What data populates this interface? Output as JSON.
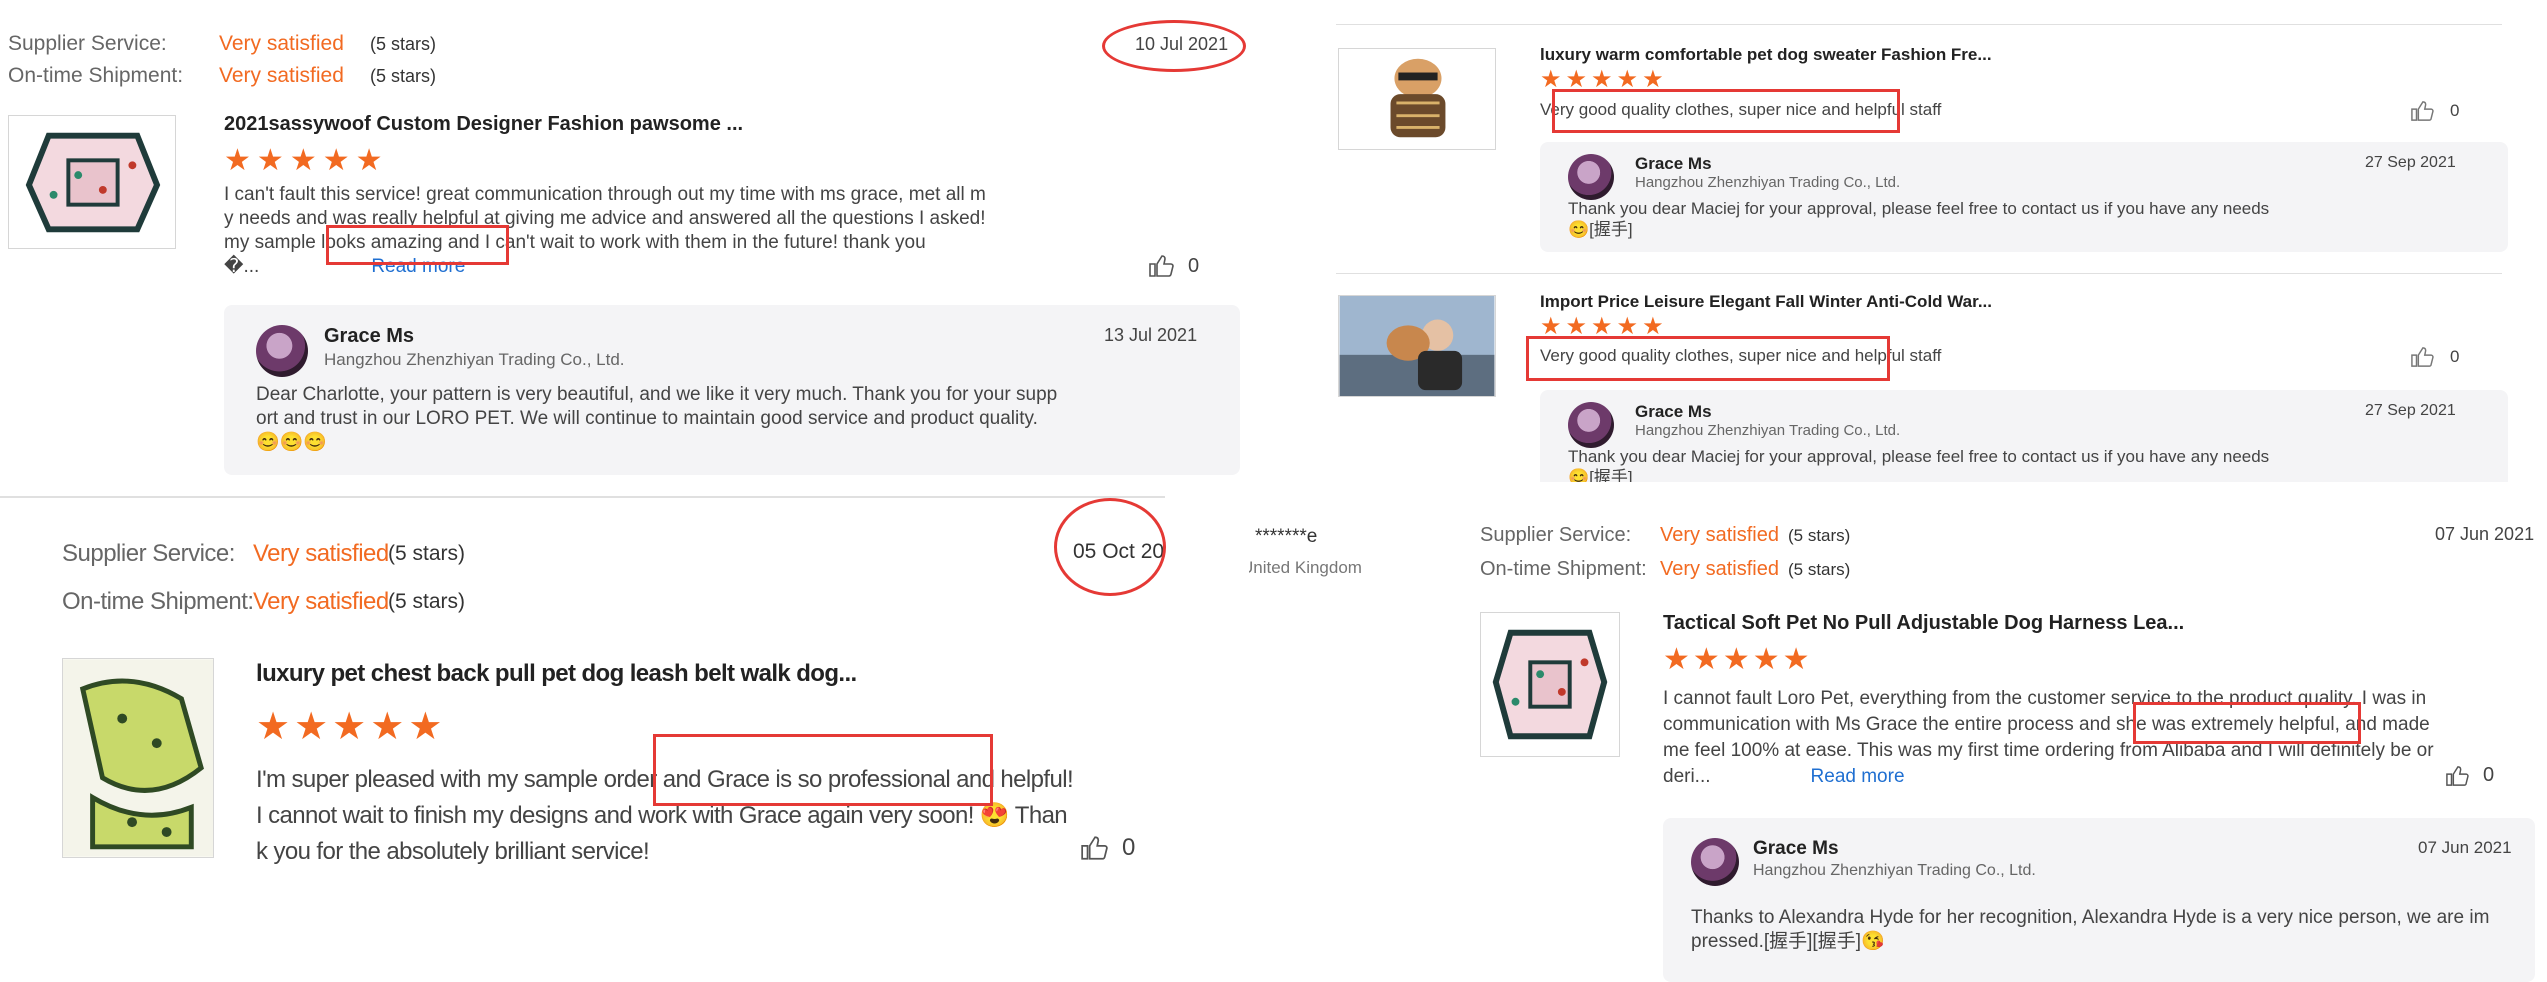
{
  "colors": {
    "accent": "#f26a21",
    "highlight": "#e53935",
    "link": "#1f6fd1",
    "reply_bg": "#f4f4f6"
  },
  "p1": {
    "supplier_label": "Supplier Service:",
    "supplier_value": "Very satisfied",
    "supplier_stars": "(5 stars)",
    "shipment_label": "On-time Shipment:",
    "shipment_value": "Very satisfied",
    "shipment_stars": "(5 stars)",
    "date": "10 Jul 2021",
    "title": "2021sassywoof Custom Designer Fashion pawsome ...",
    "rating": 5,
    "line1": "I can't fault this service! great communication through out my time with ms grace, met all m",
    "line2": "y needs and was really helpful at giving me advice and answered all the questions I asked!",
    "line3": "my sample looks amazing and I can't wait to work with them in the future! thank you",
    "line4": "�...",
    "read_more": "Read more",
    "likes": "0",
    "reply": {
      "name": "Grace Ms",
      "company": "Hangzhou Zhenzhiyan Trading Co., Ltd.",
      "date": "13 Jul 2021",
      "line1": "Dear Charlotte, your pattern is very beautiful, and we like it very much. Thank you for your supp",
      "line2": "ort and trust in our LORO PET. We will continue to maintain good service and product quality.",
      "line3": "😊😊😊"
    }
  },
  "p2": {
    "review1": {
      "title": "luxury warm comfortable pet dog sweater Fashion Fre...",
      "rating": 5,
      "text": "Very good quality clothes, super nice and helpful staff",
      "likes": "0",
      "reply": {
        "name": "Grace Ms",
        "company": "Hangzhou Zhenzhiyan Trading Co., Ltd.",
        "date": "27 Sep 2021",
        "line1": "Thank you dear Maciej for your approval, please feel free to contact us if you have any needs",
        "line2": "😊[握手]"
      }
    },
    "review2": {
      "title": "Import Price Leisure Elegant Fall Winter Anti-Cold War...",
      "rating": 5,
      "text": "Very good quality clothes, super nice and helpful staff",
      "likes": "0",
      "reply": {
        "name": "Grace Ms",
        "company": "Hangzhou Zhenzhiyan Trading Co., Ltd.",
        "date": "27 Sep 2021",
        "line1": "Thank you dear Maciej for your approval, please feel free to contact us if you have any needs",
        "line2": "😊[握手]"
      }
    }
  },
  "p3": {
    "supplier_label": "Supplier Service:",
    "supplier_value": "Very satisfied",
    "supplier_stars": "(5 stars)",
    "shipment_label": "On-time Shipment:",
    "shipment_value": "Very satisfied",
    "shipment_stars": "(5 stars)",
    "date": "05 Oct 2021",
    "title": "luxury pet chest back pull pet dog leash belt walk dog...",
    "rating": 5,
    "line1": "I'm super pleased with my sample order and Grace is so professional and helpful!",
    "line2": "I cannot wait to finish my designs and work with Grace again very soon! 😍 Than",
    "line3": "k you for the absolutely brilliant service!",
    "likes": "0"
  },
  "p4": {
    "buyer_name": "*******e",
    "buyer_country": "United Kingdom",
    "supplier_label": "Supplier Service:",
    "supplier_value": "Very satisfied",
    "supplier_stars": "(5 stars)",
    "shipment_label": "On-time Shipment:",
    "shipment_value": "Very satisfied",
    "shipment_stars": "(5 stars)",
    "date": "07 Jun 2021",
    "title": "Tactical Soft Pet No Pull Adjustable Dog Harness Lea...",
    "rating": 5,
    "line1": "I cannot fault Loro Pet, everything from the customer service to the product quality. I was in",
    "line2": "communication with Ms Grace the entire process and she was extremely helpful, and made",
    "line3": "me feel 100% at ease. This was my first time ordering from Alibaba and I will definitely be or",
    "line4": "deri...",
    "read_more": "Read more",
    "likes": "0",
    "reply": {
      "name": "Grace Ms",
      "company": "Hangzhou Zhenzhiyan Trading Co., Ltd.",
      "date": "07 Jun 2021",
      "line1": "Thanks to Alexandra Hyde for her recognition, Alexandra Hyde is a very nice person, we are im",
      "line2": "pressed.[握手][握手]😘"
    }
  }
}
